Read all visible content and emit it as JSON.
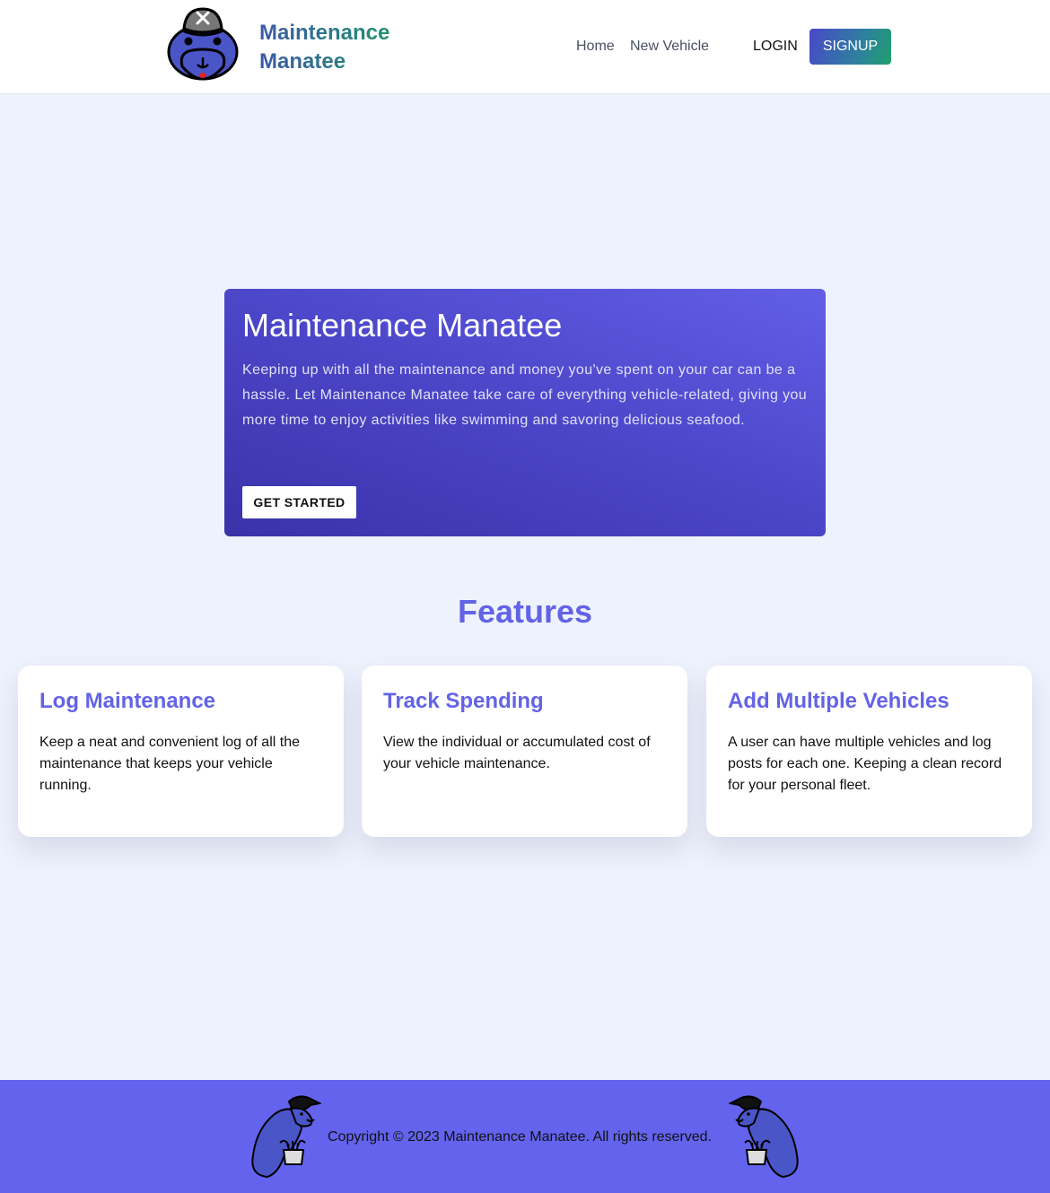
{
  "header": {
    "brand_line1": "Maintenance",
    "brand_line2": "Manatee",
    "logo_icon": "manatee-mechanic-logo",
    "nav": {
      "home": "Home",
      "new_vehicle": "New Vehicle",
      "login": "LOGIN",
      "signup": "SIGNUP"
    }
  },
  "hero": {
    "title": "Maintenance Manatee",
    "text": "Keeping up with all the maintenance and money you've spent on your car can be a hassle. Let Maintenance Manatee take care of everything vehicle-related, giving you more time to enjoy activities like swimming and savoring delicious seafood.",
    "button": "GET STARTED"
  },
  "features": {
    "title": "Features",
    "cards": [
      {
        "title": "Log Maintenance",
        "text": "Keep a neat and convenient log of all the maintenance that keeps your vehicle running."
      },
      {
        "title": "Track Spending",
        "text": "View the individual or accumulated cost of your vehicle maintenance."
      },
      {
        "title": "Add Multiple Vehicles",
        "text": "A user can have multiple vehicles and log posts for each one. Keeping a clean record for your personal fleet."
      }
    ]
  },
  "footer": {
    "copyright": "Copyright © 2023 Maintenance Manatee. All rights reserved.",
    "mascot_icon": "manatee-with-bucket-icon"
  },
  "colors": {
    "page_bg": "#eef2fc",
    "accent": "#6363e6",
    "footer_bg": "#6363ee",
    "hero_start": "#3a32a8",
    "hero_end": "#625ee6",
    "brand_blue": "#3b5aa6",
    "brand_green": "#1e9a66"
  }
}
